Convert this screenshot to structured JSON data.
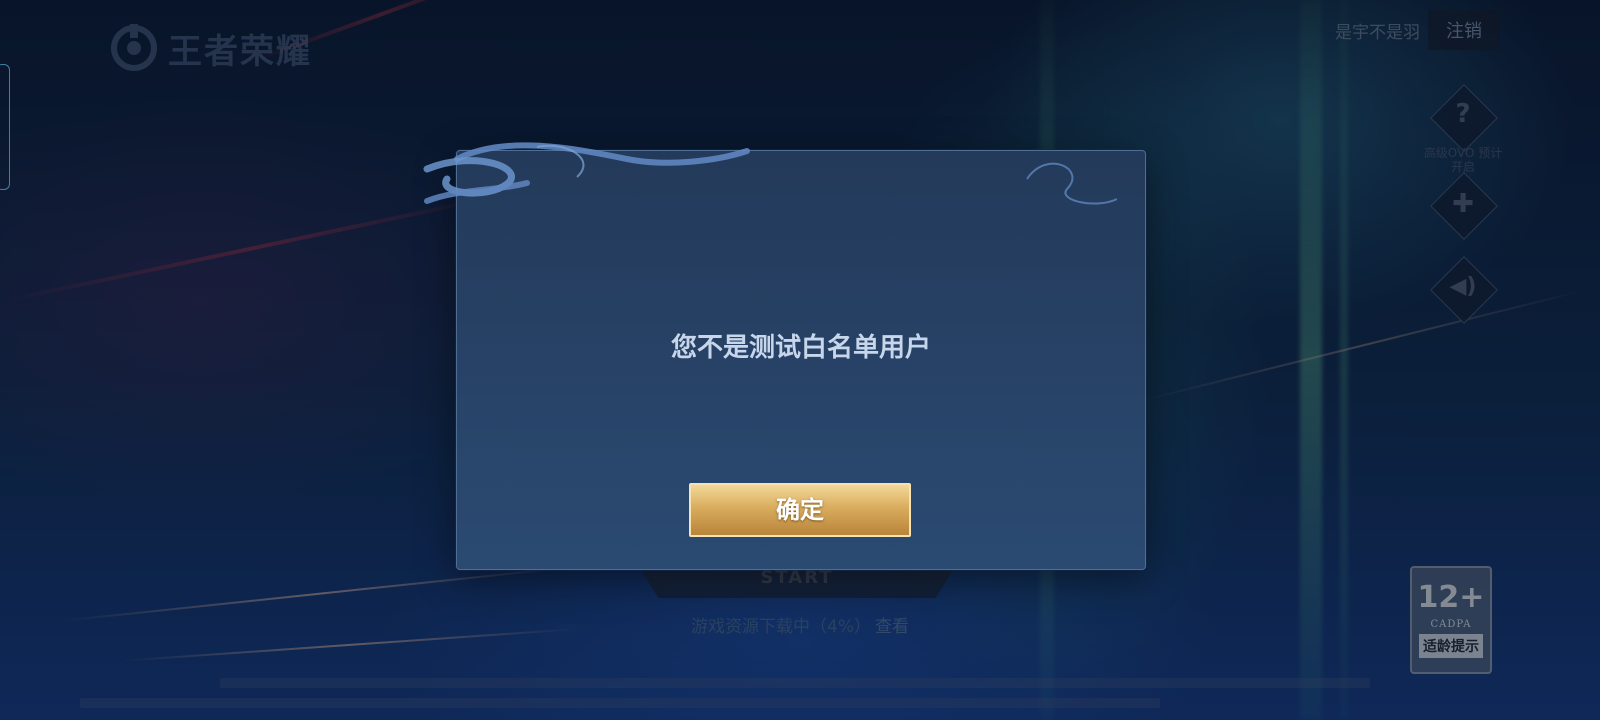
{
  "header": {
    "logo_text": "王者荣耀",
    "account_name": "是宇不是羽",
    "logout_label": "注销"
  },
  "sidebar_right": {
    "help_glyph": "?",
    "help_label": "高级OVO 预计开启",
    "controller_glyph": "✚",
    "sound_glyph": "◀)"
  },
  "main": {
    "start_label": "START",
    "download_status": "游戏资源下载中（4%）",
    "download_link": "查看"
  },
  "age_rating": {
    "age": "12+",
    "org": "CADPA",
    "tip": "适龄提示"
  },
  "dialog": {
    "message": "您不是测试白名单用户",
    "confirm_label": "确定"
  },
  "colors": {
    "dialog_bg": "#2b4a72",
    "dialog_border": "#4f6e96",
    "button_gold": "#d9ac5e",
    "message_text": "#c7d6ea"
  },
  "icons": [
    "logo-icon",
    "help-icon",
    "controller-icon",
    "speaker-icon"
  ]
}
